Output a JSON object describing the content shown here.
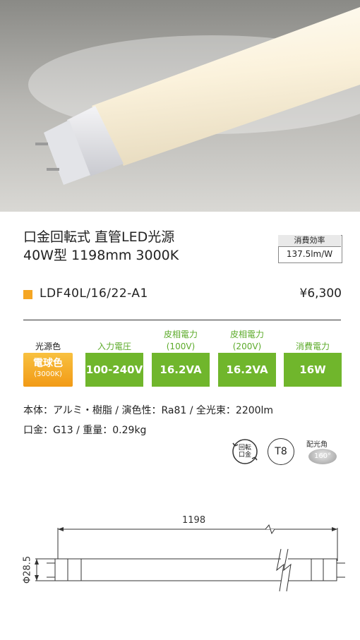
{
  "title": {
    "line1": "口金回転式 直管LED光源",
    "line2": "40W型 1198mm 3000K"
  },
  "efficiency": {
    "label": "消費効率",
    "value": "137.5lm/W"
  },
  "model": "LDF40L/16/22-A1",
  "price": "¥6,300",
  "specs": {
    "light_color": {
      "header": "光源色",
      "value": "電球色",
      "sub": "(3000K)"
    },
    "columns": [
      {
        "header1": "入力電圧",
        "header2": "",
        "value": "100-240V"
      },
      {
        "header1": "皮相電力",
        "header2": "(100V)",
        "value": "16.2VA"
      },
      {
        "header1": "皮相電力",
        "header2": "(200V)",
        "value": "16.2VA"
      },
      {
        "header1": "消費電力",
        "header2": "",
        "value": "16W"
      }
    ]
  },
  "details": {
    "line1": "本体：アルミ・樹脂 / 演色性：Ra81 / 全光束：2200lm",
    "line2": "口金：G13 / 重量：0.29kg"
  },
  "icons": {
    "rotate": {
      "line1": "回転",
      "line2": "口金"
    },
    "tube": "T8",
    "beam_label": "配光角",
    "beam_value": "160°"
  },
  "drawing": {
    "length": "1198",
    "diameter": "Φ28.5"
  },
  "colors": {
    "accent_orange": "#f5a623",
    "green": "#70b62c",
    "green_text": "#5cab2a"
  }
}
